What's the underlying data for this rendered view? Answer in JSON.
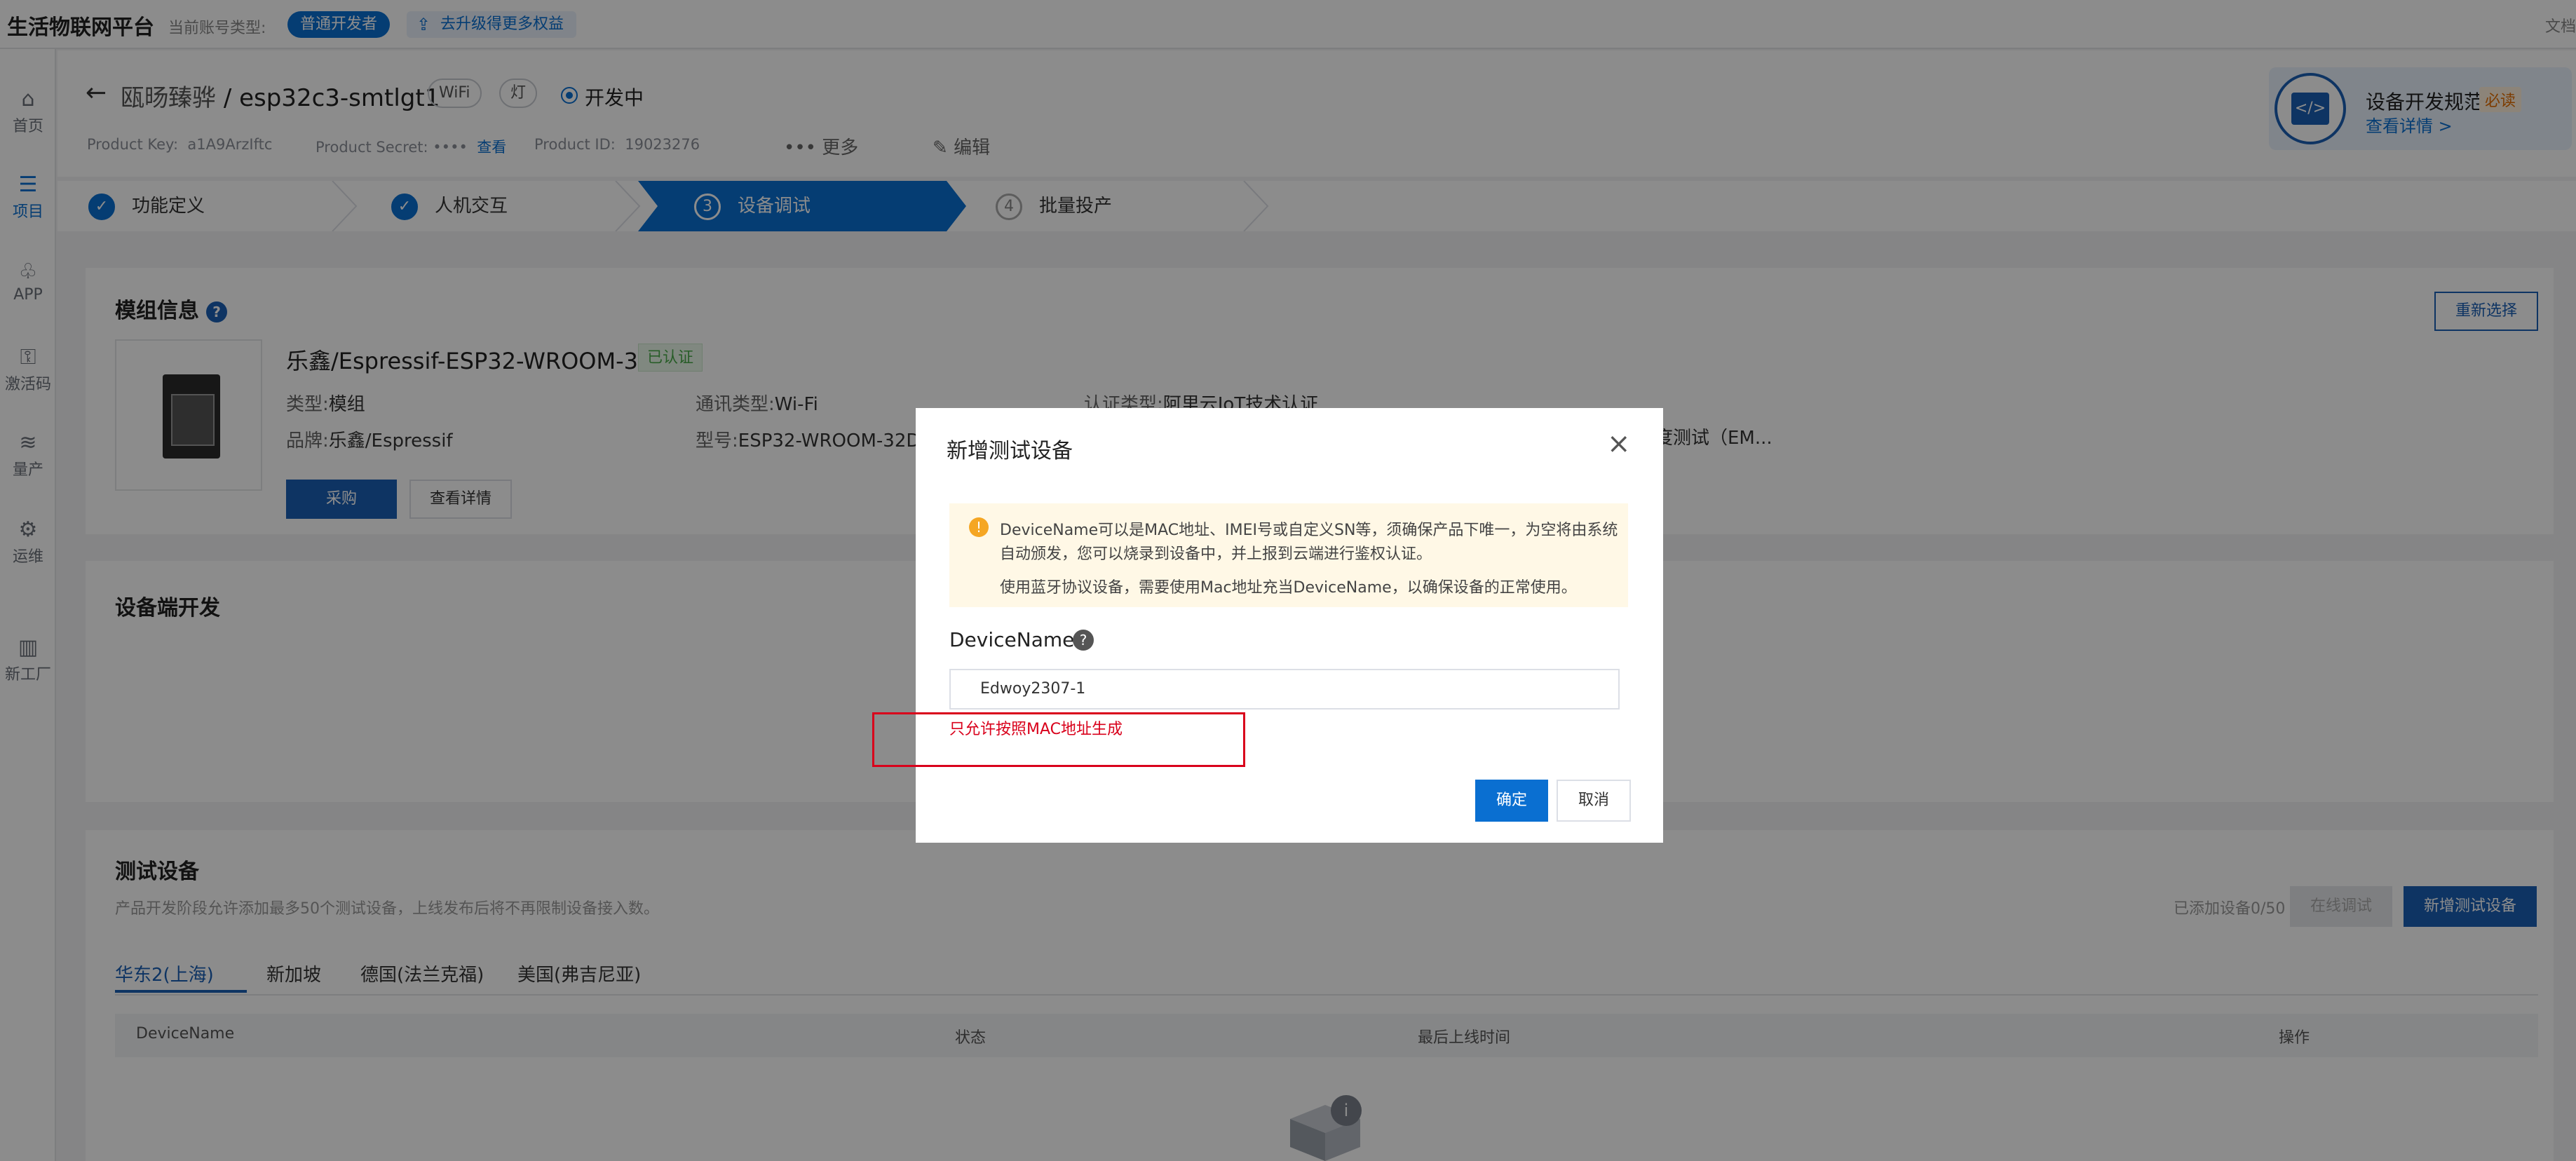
{
  "topbar": {
    "brand": "生活物联网平台",
    "account_type_label": "当前账号类型:",
    "account_type_badge": "普通开发者",
    "upgrade": "去升级得更多权益",
    "docs": "文档"
  },
  "sidebar": {
    "items": [
      {
        "label": "首页",
        "icon": "home-icon"
      },
      {
        "label": "项目",
        "icon": "project-icon"
      },
      {
        "label": "APP",
        "icon": "app-icon"
      },
      {
        "label": "激活码",
        "icon": "key-icon"
      },
      {
        "label": "量产",
        "icon": "layers-icon"
      },
      {
        "label": "运维",
        "icon": "ops-icon"
      },
      {
        "label": "新工厂",
        "icon": "factory-icon"
      }
    ]
  },
  "header": {
    "project": "瓯旸臻骅",
    "sep": "/",
    "product": "esp32c3-smtlgt1",
    "tags": [
      "WiFi",
      "灯"
    ],
    "status": "开发中",
    "product_key_label": "Product Key:",
    "product_key": "a1A9ArzIftc",
    "product_secret_label": "Product Secret:",
    "product_secret": "••••",
    "product_secret_link": "查看",
    "product_id_label": "Product ID:",
    "product_id": "19023276",
    "more": "更多",
    "edit": "编辑"
  },
  "spec": {
    "title": "设备开发规范",
    "must": "必读",
    "link": "查看详情 >"
  },
  "steps": [
    {
      "num": "✓",
      "label": "功能定义"
    },
    {
      "num": "✓",
      "label": "人机交互"
    },
    {
      "num": "3",
      "label": "设备调试"
    },
    {
      "num": "4",
      "label": "批量投产"
    }
  ],
  "module": {
    "title": "模组信息",
    "reselect": "重新选择",
    "name": "乐鑫/Espressif-ESP32-WROOM-32D",
    "cert": "已认证",
    "type_label": "类型:",
    "type": "模组",
    "brand_label": "品牌:",
    "brand": "乐鑫/Espressif",
    "comm_label": "通讯类型:",
    "comm": "Wi-Fi",
    "model_label": "型号:",
    "model": "ESP32-WROOM-32D",
    "auth_label": "认证类型:",
    "auth": "阿里云IoT技术认证",
    "extra": "度测试（EM...",
    "buy": "采购",
    "details": "查看详情"
  },
  "device_dev": {
    "title": "设备端开发"
  },
  "test_devices": {
    "title": "测试设备",
    "desc": "产品开发阶段允许添加最多50个测试设备，上线发布后将不再限制设备接入数。",
    "added": "已添加设备0/50",
    "online_debug": "在线调试",
    "add_btn": "新增测试设备",
    "regions": [
      "华东2(上海)",
      "新加坡",
      "德国(法兰克福)",
      "美国(弗吉尼亚)"
    ],
    "columns": [
      "DeviceName",
      "状态",
      "最后上线时间",
      "操作"
    ]
  },
  "modal": {
    "title": "新增测试设备",
    "alert_lines": [
      "DeviceName可以是MAC地址、IMEI号或自定义SN等，须确保产品下唯一，为空将由系统",
      "自动颁发，您可以烧录到设备中，并上报到云端进行鉴权认证。",
      "使用蓝牙协议设备，需要使用Mac地址充当DeviceName，以确保设备的正常使用。"
    ],
    "field_label": "DeviceName",
    "field_value": "Edwoy2307-1",
    "error": "只允许按照MAC地址生成",
    "ok": "确定",
    "cancel": "取消"
  }
}
